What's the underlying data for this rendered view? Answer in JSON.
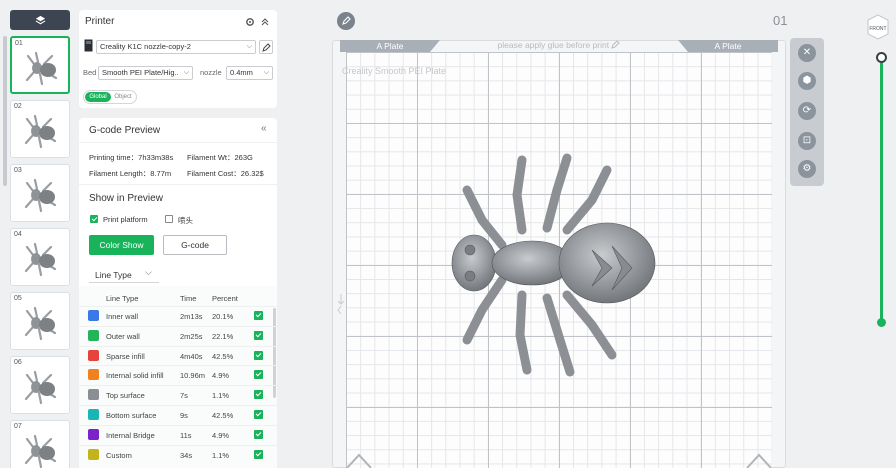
{
  "objects_panel": {
    "items": [
      {
        "num": "01",
        "selected": true
      },
      {
        "num": "02",
        "selected": false
      },
      {
        "num": "03",
        "selected": false
      },
      {
        "num": "04",
        "selected": false
      },
      {
        "num": "05",
        "selected": false
      },
      {
        "num": "06",
        "selected": false
      },
      {
        "num": "07",
        "selected": false
      }
    ]
  },
  "printer": {
    "title": "Printer",
    "printer_name": "Creality K1C nozzle-copy-2",
    "bed_label": "Bed",
    "bed_value": "Smooth PEI Plate/Hig..",
    "nozzle_label": "nozzle",
    "nozzle_value": "0.4mm",
    "tab_global": "Global",
    "tab_object": "Object"
  },
  "gcode_preview": {
    "title": "G-code Preview",
    "printing_time": "Printing time：7h33m38s",
    "filament_wt": "Filament Wt：263G",
    "filament_length": "Filament Length：8.77m",
    "filament_cost": "Filament Cost：26.32$",
    "show_in_preview": "Show in Preview",
    "print_platform": "Print platform",
    "nozzle_cn": "喷头",
    "color_show": "Color Show",
    "gcode_btn": "G-code",
    "line_type_select": "Line Type",
    "col_line_type": "Line Type",
    "col_time": "Time",
    "col_percent": "Percent",
    "rows": [
      {
        "label": "Inner wall",
        "time": "2m13s",
        "percent": "20.1%",
        "color": "#3b78e7"
      },
      {
        "label": "Outer wall",
        "time": "2m25s",
        "percent": "22.1%",
        "color": "#23b45a"
      },
      {
        "label": "Sparse infill",
        "time": "4m40s",
        "percent": "42.5%",
        "color": "#e8423d"
      },
      {
        "label": "Internal solid infill",
        "time": "10.96m",
        "percent": "4.9%",
        "color": "#f08020"
      },
      {
        "label": "Top surface",
        "time": "7s",
        "percent": "1.1%",
        "color": "#8a8f95"
      },
      {
        "label": "Bottom surface",
        "time": "9s",
        "percent": "42.5%",
        "color": "#1ab5b5"
      },
      {
        "label": "Internal Bridge",
        "time": "11s",
        "percent": "4.9%",
        "color": "#7b22c9"
      },
      {
        "label": "Custom",
        "time": "34s",
        "percent": "1.1%",
        "color": "#c2b41a"
      }
    ]
  },
  "plate": {
    "tab_left": "A Plate",
    "tab_right": "A Plate",
    "glue_notice": "please apply glue before print",
    "plate_type": "Creality Smooth PEI Plate",
    "number": "01"
  },
  "view_cube": {
    "face": "FRONT"
  },
  "toolbar_icons": [
    "close-icon",
    "arrange-icon",
    "auto-orient-icon",
    "lock-icon",
    "settings-icon"
  ]
}
